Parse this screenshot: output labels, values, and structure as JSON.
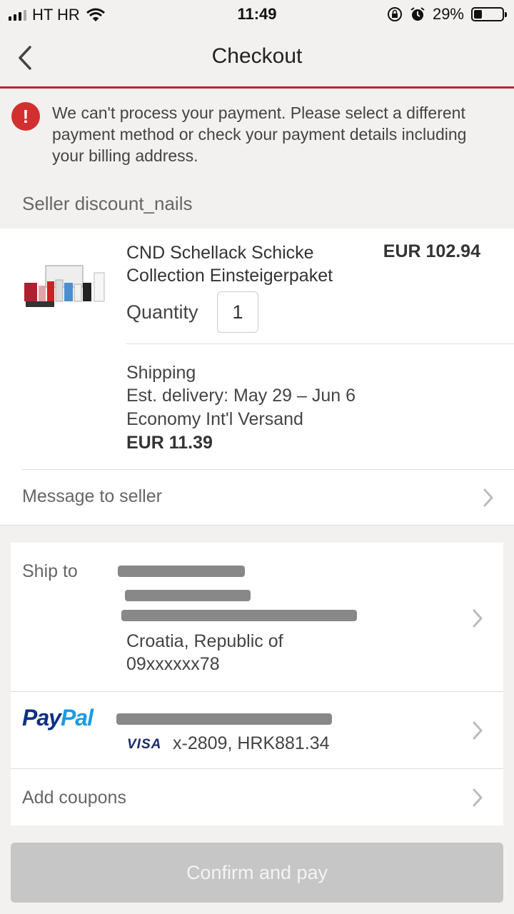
{
  "status_bar": {
    "carrier": "HT HR",
    "time": "11:49",
    "battery": "29%",
    "battery_level": 0.29
  },
  "header": {
    "title": "Checkout"
  },
  "error": {
    "message": "We can't process your payment. Please select a different payment method or check your payment details including your billing address."
  },
  "seller": {
    "label": "Seller discount_nails"
  },
  "item": {
    "title": "CND Schellack Schicke Collection Einsteigerpaket",
    "price": "EUR 102.94",
    "quantity_label": "Quantity",
    "quantity": "1"
  },
  "shipping": {
    "label": "Shipping",
    "delivery": "Est. delivery: May 29 – Jun 6",
    "method": "Economy Int'l Versand",
    "cost": "EUR 11.39"
  },
  "message_row": {
    "label": "Message to seller"
  },
  "ship_to": {
    "label": "Ship to",
    "country": "Croatia, Republic of",
    "phone": "09xxxxxx78"
  },
  "payment": {
    "brand_pay": "Pay",
    "brand_pal": "Pal",
    "card_brand": "VISA",
    "card_detail": "x-2809, HRK881.34"
  },
  "coupons": {
    "label": "Add coupons"
  },
  "confirm_button": {
    "label": "Confirm and pay"
  }
}
